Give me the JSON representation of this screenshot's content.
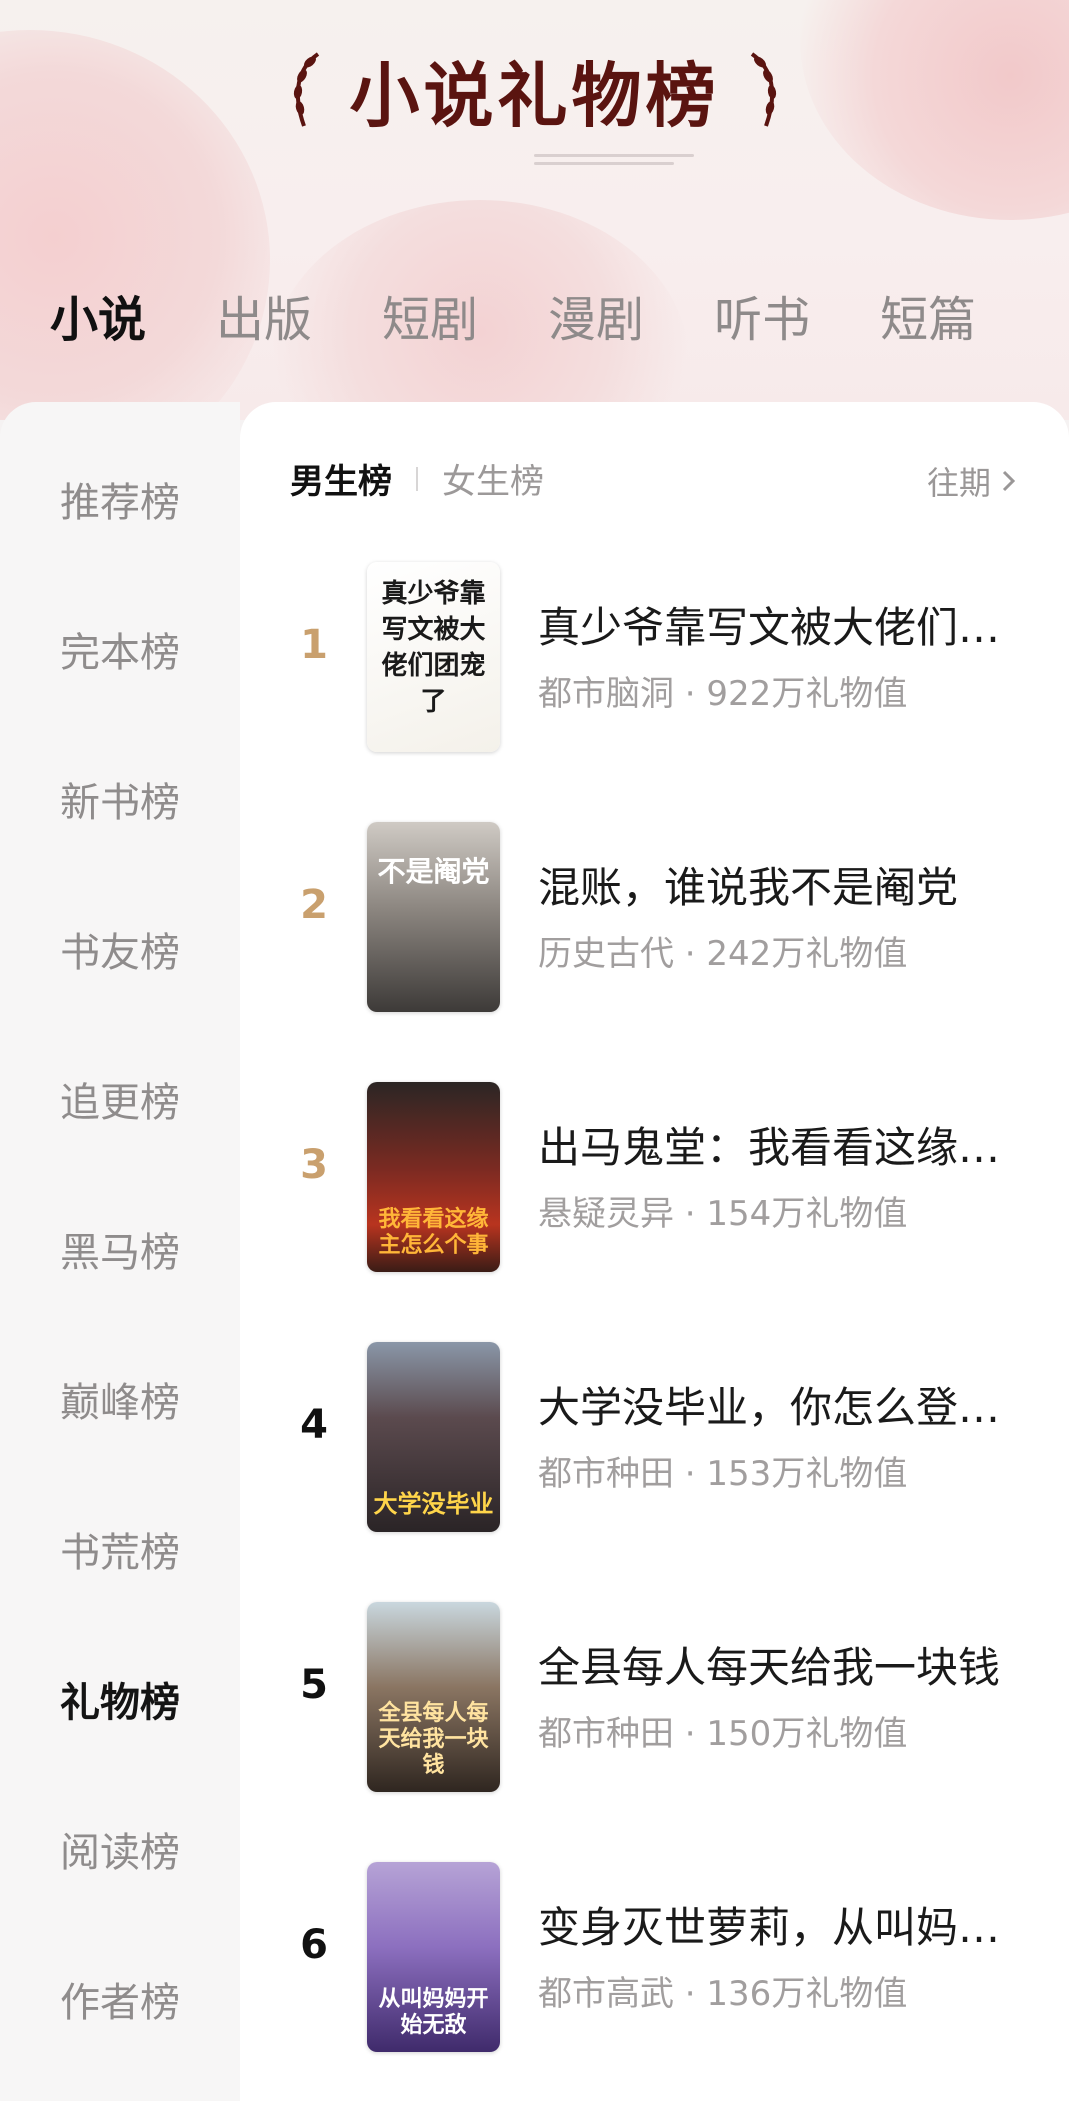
{
  "header": {
    "title": "小说礼物榜",
    "tabs": [
      {
        "label": "小说",
        "active": true
      },
      {
        "label": "出版",
        "active": false
      },
      {
        "label": "短剧",
        "active": false
      },
      {
        "label": "漫剧",
        "active": false
      },
      {
        "label": "听书",
        "active": false
      },
      {
        "label": "短篇",
        "active": false
      }
    ]
  },
  "sidebar": {
    "items": [
      {
        "label": "推荐榜",
        "active": false
      },
      {
        "label": "完本榜",
        "active": false
      },
      {
        "label": "新书榜",
        "active": false
      },
      {
        "label": "书友榜",
        "active": false
      },
      {
        "label": "追更榜",
        "active": false
      },
      {
        "label": "黑马榜",
        "active": false
      },
      {
        "label": "巅峰榜",
        "active": false
      },
      {
        "label": "书荒榜",
        "active": false
      },
      {
        "label": "礼物榜",
        "active": true
      },
      {
        "label": "阅读榜",
        "active": false
      },
      {
        "label": "作者榜",
        "active": false
      }
    ]
  },
  "main": {
    "subtabs": [
      {
        "label": "男生榜",
        "active": true
      },
      {
        "label": "女生榜",
        "active": false
      }
    ],
    "history_label": "往期",
    "books": [
      {
        "rank": "1",
        "title": "真少爷靠写文被大佬们…",
        "meta": "都市脑洞 · 922万礼物值",
        "cover_text": "真少爷靠写文被大佬们团宠了"
      },
      {
        "rank": "2",
        "title": "混账，谁说我不是阉党",
        "meta": "历史古代 · 242万礼物值",
        "cover_text": "不是阉党"
      },
      {
        "rank": "3",
        "title": "出马鬼堂：我看看这缘…",
        "meta": "悬疑灵异 · 154万礼物值",
        "cover_text": "我看看这缘主怎么个事"
      },
      {
        "rank": "4",
        "title": "大学没毕业，你怎么登…",
        "meta": "都市种田 · 153万礼物值",
        "cover_text": "大学没毕业"
      },
      {
        "rank": "5",
        "title": "全县每人每天给我一块钱",
        "meta": "都市种田 · 150万礼物值",
        "cover_text": "全县每人每天给我一块钱"
      },
      {
        "rank": "6",
        "title": "变身灭世萝莉，从叫妈…",
        "meta": "都市高武 · 136万礼物值",
        "cover_text": "从叫妈妈开始无敌"
      }
    ]
  },
  "colors": {
    "title": "#5a1410",
    "rank_gold": "#c9a06e",
    "active_text": "#111111",
    "inactive_text": "#8e8a8a"
  }
}
